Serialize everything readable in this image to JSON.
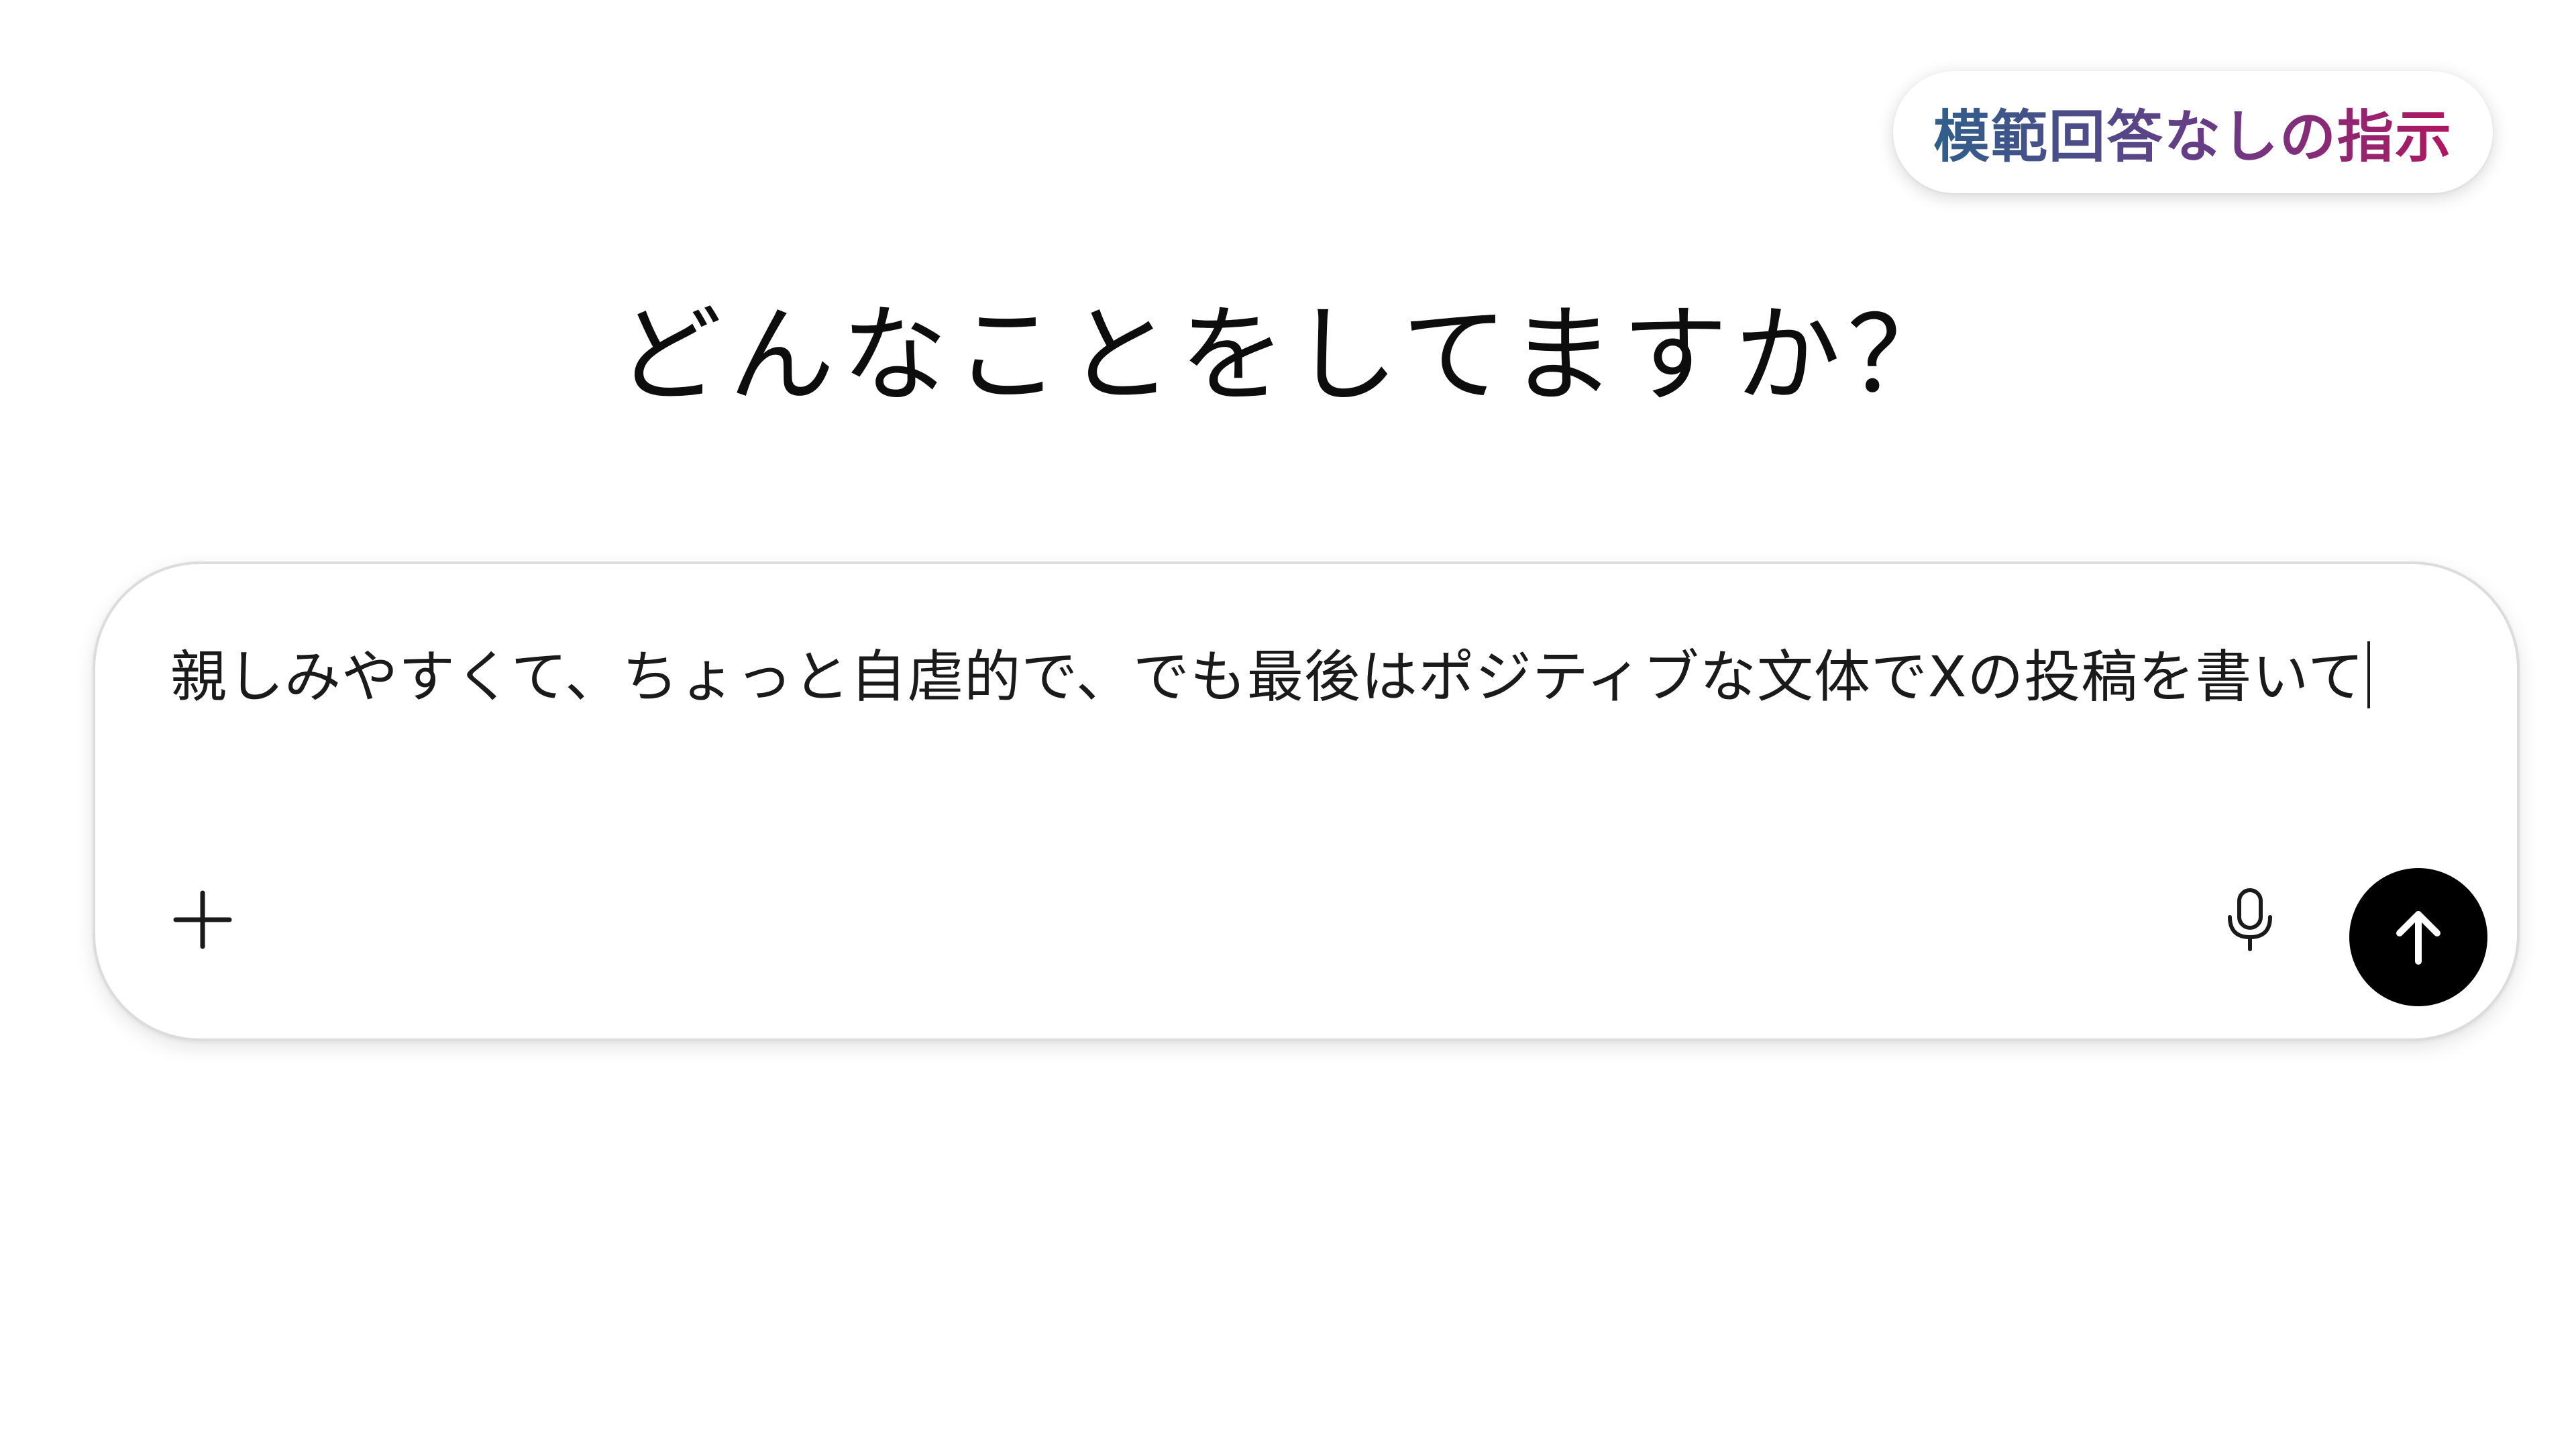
{
  "badge": {
    "label": "模範回答なしの指示",
    "gradient_start": "#2f5f8a",
    "gradient_end": "#b01660"
  },
  "heading": "どんなことをしてますか？",
  "composer": {
    "input_text": "親しみやすくて、ちょっと自虐的で、でも最後はポジティブな文体でXの投稿を書いて",
    "add_icon": "plus-icon",
    "mic_icon": "microphone-icon",
    "send_icon": "arrow-up-icon",
    "send_button_color": "#000000"
  }
}
